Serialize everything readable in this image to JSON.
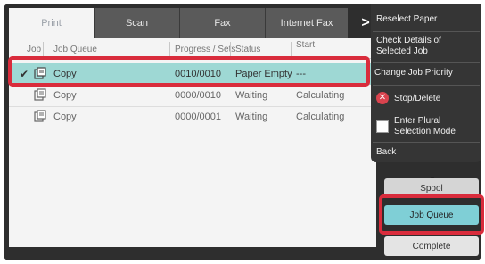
{
  "tabs": [
    "Print",
    "Scan",
    "Fax",
    "Internet Fax"
  ],
  "tab_arrow": ">",
  "columns": {
    "job": "Job",
    "queue": "Job Queue",
    "progress": "Progress / Sets",
    "status": "Status",
    "start": "Start"
  },
  "rows": [
    {
      "queue": "Copy",
      "progress": "0010/0010",
      "status": "Paper Empty",
      "start": "---",
      "selected": true
    },
    {
      "queue": "Copy",
      "progress": "0000/0010",
      "status": "Waiting",
      "start": "Calculating",
      "selected": false
    },
    {
      "queue": "Copy",
      "progress": "0000/0001",
      "status": "Waiting",
      "start": "Calculating",
      "selected": false
    }
  ],
  "menu": {
    "reselect": "Reselect Paper",
    "check_details_1": "Check Details of",
    "check_details_2": "Selected Job",
    "change_priority": "Change Job Priority",
    "stop_delete": "Stop/Delete",
    "plural_1": "Enter Plural",
    "plural_2": "Selection Mode",
    "back": "Back"
  },
  "buttons": {
    "spool": "Spool",
    "job_queue": "Job Queue",
    "complete": "Complete"
  },
  "colors": {
    "selected_row": "#9ed8d4",
    "highlight": "#d92c3c",
    "active_button": "#7fcfd6",
    "menu_bg": "#353535"
  }
}
